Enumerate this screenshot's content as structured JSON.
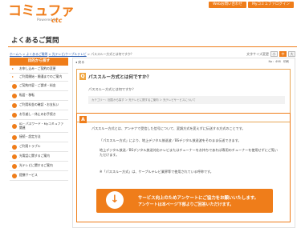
{
  "header": {
    "logo": "コミュファ",
    "logo_sub": "Powered by",
    "logo_brand": "ctc",
    "buttons": [
      "Webお問い合わせ",
      "Myコミュファログイン"
    ]
  },
  "page_title": "よくあるご質問",
  "breadcrumb": {
    "items": [
      "ホームへ",
      "> よくあるご質問",
      "> 光テレビ/ケーブルテレビ",
      "> パススルー方式とは何ですか？"
    ]
  },
  "font_size": {
    "label": "文字サイズ変更",
    "options": [
      "小",
      "中",
      "大"
    ]
  },
  "sidebar": {
    "heading": "目的から探す",
    "items": [
      {
        "label": "お申し込み・ご契約の変更"
      },
      {
        "label": "ご利用開始・開通までのご案内"
      },
      {
        "label": "ご契約内容・ご請求・料金"
      },
      {
        "label": "転居・移転"
      },
      {
        "label": "ご利用料金の確認・お支払い"
      },
      {
        "label": "お引越し・休止のお手続き"
      },
      {
        "label": "ID・パスワード・Myコミュファ 関連"
      },
      {
        "label": "接続・設定方法"
      },
      {
        "label": "ご利用トラブル"
      },
      {
        "label": "光電話に関するご案内"
      },
      {
        "label": "光テレビに関するご案内"
      },
      {
        "label": "提携サービス"
      }
    ]
  },
  "main": {
    "back_label": "戻る",
    "toolbar": [
      "No：498",
      "印刷"
    ],
    "question": {
      "badge": "Q",
      "title": "パススルー方式とは何ですか？",
      "text": "パススルー方式とは何ですか？",
      "category": "カテゴリー：回答から探す ＞ 光テレビに関するご案内 ＞ 光テレビサービスについて"
    },
    "answer": {
      "badge": "A",
      "paragraph1": "パススルー方式とは、アンテナで受信した信号について、変調方式を変えずに伝送する方式のことです。",
      "paragraph2": "「パススルー方式」により、地上デジタル放送波／BSデジタル放送波をそのまま伝送できます。",
      "paragraph3": "地上デジタル放送／BSデジタル放送対応テレビまたはチューナーをお持ちであれば専用のチューナーを使用せずにご覧いただけます。",
      "note": "※「パススルー方式」は、ケーブルテレビ業界等で使用されている呼称です。"
    }
  },
  "banner": {
    "line1": "サービス向上のためアンケートにご協力をお願いいたします。",
    "line2": "アンケートは本ページ下部よりご回答いただけます。"
  },
  "colors": {
    "accent": "#ef7d1a"
  }
}
